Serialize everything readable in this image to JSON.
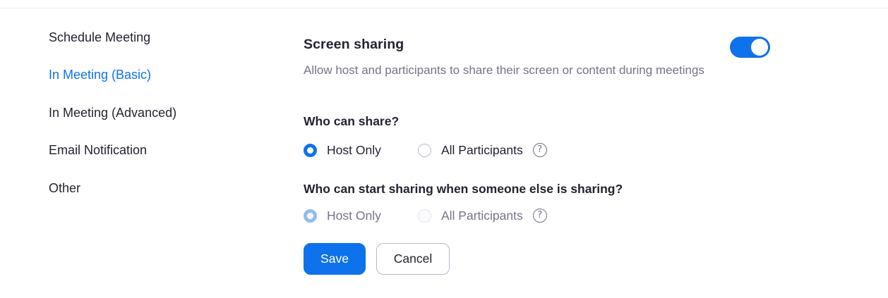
{
  "sidebar": {
    "items": [
      {
        "label": "Schedule Meeting",
        "active": false
      },
      {
        "label": "In Meeting (Basic)",
        "active": true
      },
      {
        "label": "In Meeting (Advanced)",
        "active": false
      },
      {
        "label": "Email Notification",
        "active": false
      },
      {
        "label": "Other",
        "active": false
      }
    ]
  },
  "setting": {
    "title": "Screen sharing",
    "description": "Allow host and participants to share their screen or content during meetings",
    "enabled": true
  },
  "who_can_share": {
    "question": "Who can share?",
    "options": [
      "Host Only",
      "All Participants"
    ],
    "selected": "Host Only",
    "help_icon": "question-mark-circle-icon"
  },
  "who_can_start": {
    "question": "Who can start sharing when someone else is sharing?",
    "options": [
      "Host Only",
      "All Participants"
    ],
    "selected": "Host Only",
    "disabled": true,
    "help_icon": "question-mark-circle-icon"
  },
  "actions": {
    "save_label": "Save",
    "cancel_label": "Cancel"
  },
  "colors": {
    "accent": "#0e72ed",
    "text": "#232333",
    "muted": "#747487"
  }
}
